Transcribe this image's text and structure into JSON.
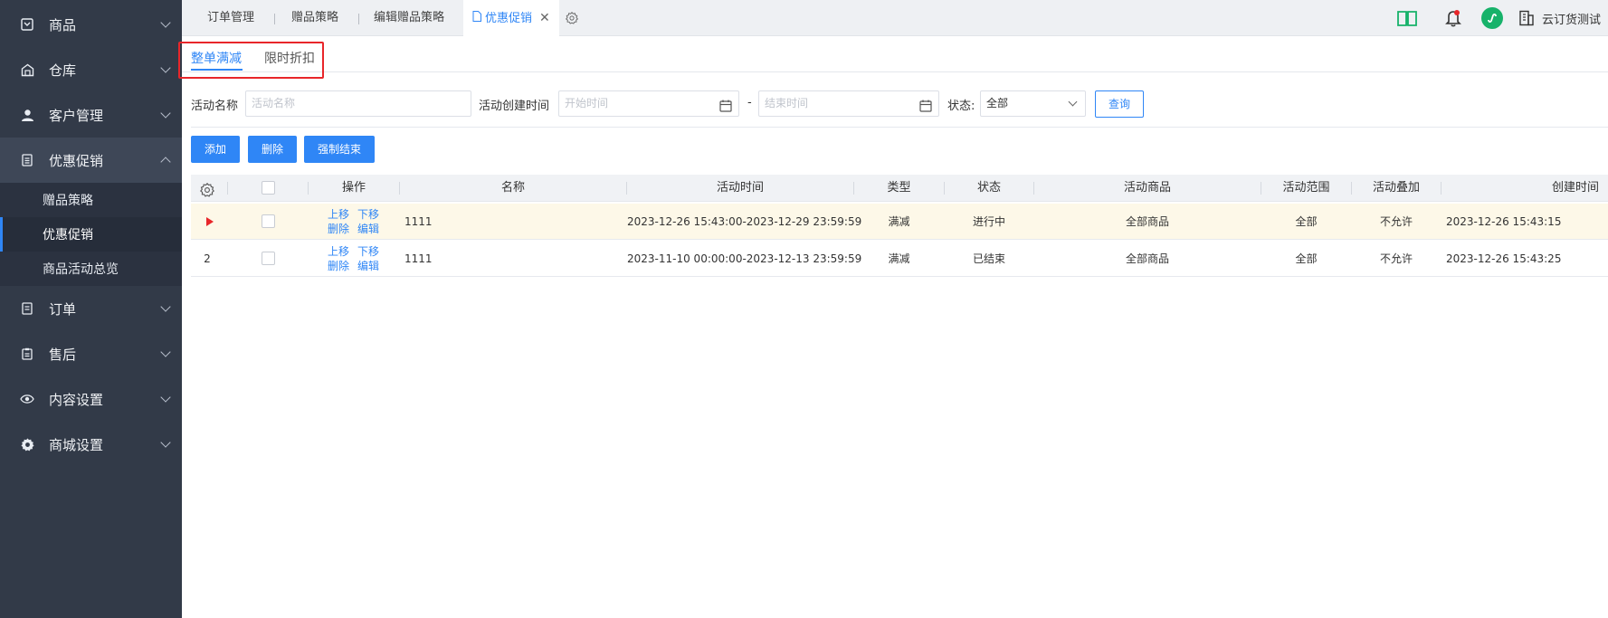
{
  "sidebar": {
    "items": [
      {
        "label": "商品",
        "icon": "product-icon"
      },
      {
        "label": "仓库",
        "icon": "warehouse-icon"
      },
      {
        "label": "客户管理",
        "icon": "user-icon"
      },
      {
        "label": "优惠促销",
        "icon": "promotion-icon"
      },
      {
        "label": "订单",
        "icon": "order-icon"
      },
      {
        "label": "售后",
        "icon": "aftersale-icon"
      },
      {
        "label": "内容设置",
        "icon": "eye-icon"
      },
      {
        "label": "商城设置",
        "icon": "gear-icon"
      }
    ],
    "sub_items": [
      {
        "label": "赠品策略"
      },
      {
        "label": "优惠促销"
      },
      {
        "label": "商品活动总览"
      }
    ]
  },
  "tabs": {
    "items": [
      {
        "label": "订单管理"
      },
      {
        "label": "赠品策略"
      },
      {
        "label": "编辑赠品策略"
      },
      {
        "label": "优惠促销"
      }
    ],
    "close": "✕",
    "org_name": "云订货测试"
  },
  "subtabs": {
    "items": [
      {
        "label": "整单满减"
      },
      {
        "label": "限时折扣"
      }
    ]
  },
  "filter": {
    "name_label": "活动名称",
    "name_placeholder": "活动名称",
    "time_label": "活动创建时间",
    "start_placeholder": "开始时间",
    "range_sep": "-",
    "end_placeholder": "结束时间",
    "status_label": "状态:",
    "status_value": "全部",
    "query_button": "查询"
  },
  "actions": {
    "add": "添加",
    "delete": "删除",
    "force_end": "强制结束"
  },
  "table": {
    "columns": [
      "操作",
      "名称",
      "活动时间",
      "类型",
      "状态",
      "活动商品",
      "活动范围",
      "活动叠加",
      "创建时间"
    ],
    "rows": [
      {
        "index": "",
        "op_up": "上移",
        "op_down": "下移",
        "op_delete": "删除",
        "op_edit": "编辑",
        "name": "1111",
        "time": "2023-12-26 15:43:00-2023-12-29 23:59:59",
        "type": "满减",
        "status": "进行中",
        "goods": "全部商品",
        "scope": "全部",
        "stack": "不允许",
        "created": "2023-12-26 15:43:15"
      },
      {
        "index": "2",
        "op_up": "上移",
        "op_down": "下移",
        "op_delete": "删除",
        "op_edit": "编辑",
        "name": "1111",
        "time": "2023-11-10 00:00:00-2023-12-13 23:59:59",
        "type": "满减",
        "status": "已结束",
        "goods": "全部商品",
        "scope": "全部",
        "stack": "不允许",
        "created": "2023-12-26 15:43:25"
      }
    ]
  },
  "colors": {
    "accent": "#2f86f6",
    "sidebar_bg": "#323a48",
    "highlight_red": "#e8262a",
    "row_highlight": "#fdf8e8"
  }
}
